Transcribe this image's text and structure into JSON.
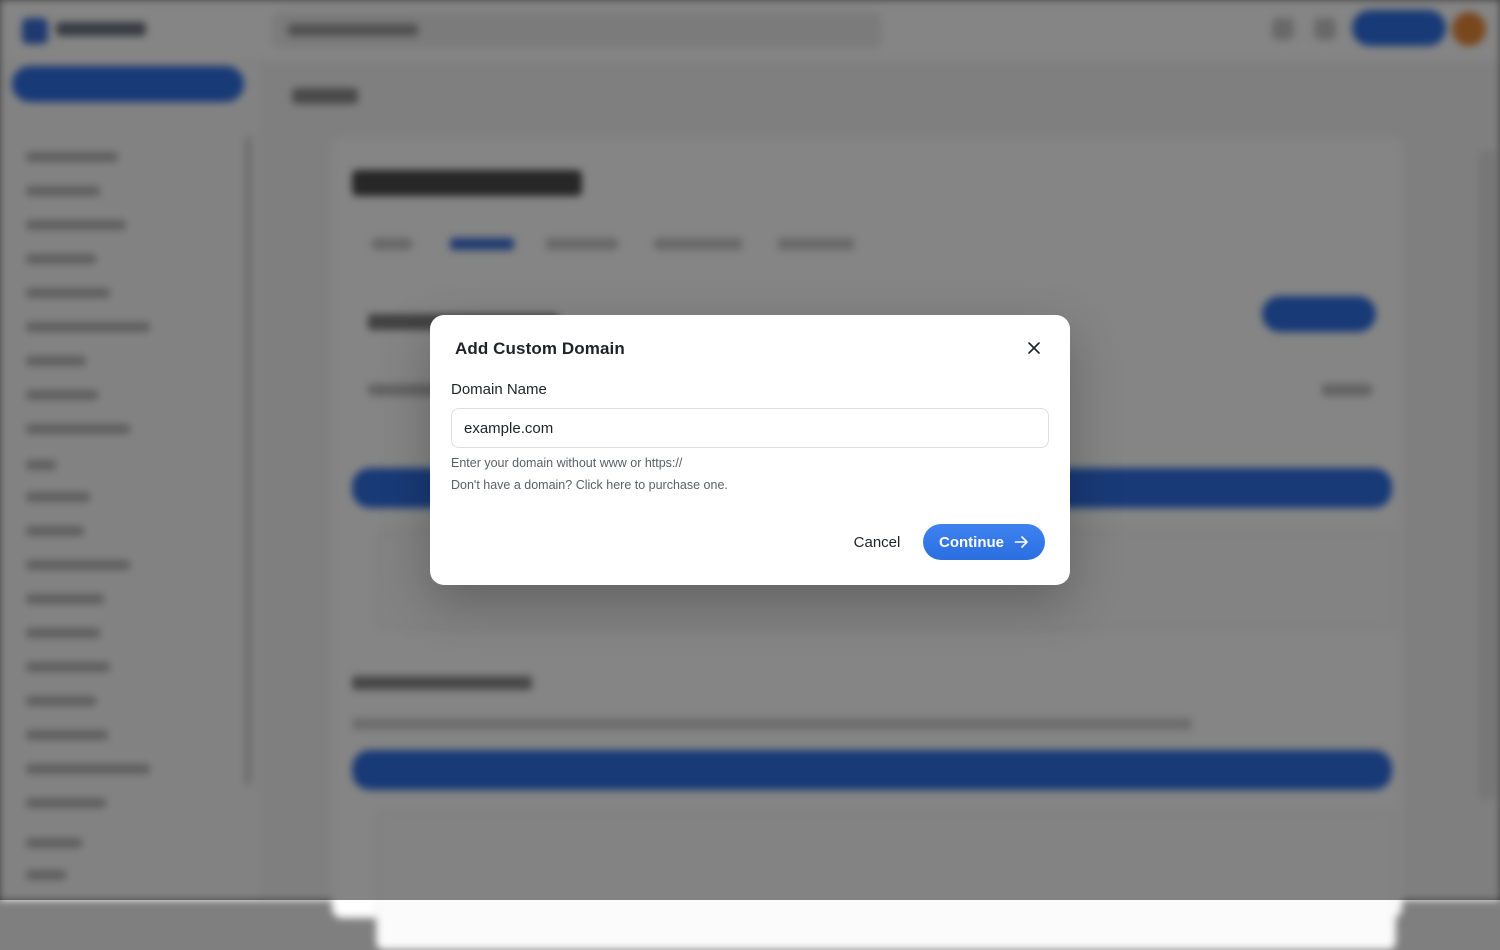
{
  "modal": {
    "title": "Add Custom Domain",
    "field_label": "Domain Name",
    "input_value": "example.com",
    "help_line1": "Enter your domain without www or https://",
    "help_line2_prefix": "Don't have a domain? ",
    "help_line2_link": "Click here to purchase one.",
    "cancel_label": "Cancel",
    "continue_label": "Continue",
    "close_icon": "close-icon",
    "continue_icon": "arrow-right-icon"
  },
  "colors": {
    "primary": "#2f6fe4",
    "overlay": "rgba(0,0,0,0.48)",
    "text": "#1f2328",
    "muted_text": "#5b6068"
  }
}
